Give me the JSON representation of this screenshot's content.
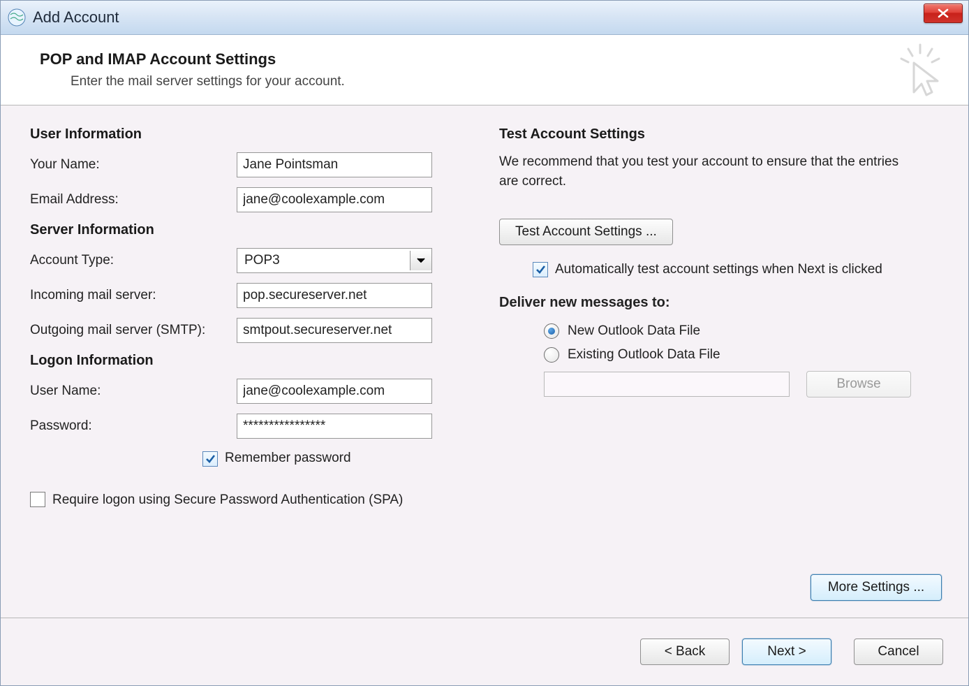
{
  "window": {
    "title": "Add Account"
  },
  "header": {
    "title": "POP and IMAP Account Settings",
    "subtitle": "Enter the mail server settings for your account."
  },
  "user_info": {
    "section": "User Information",
    "name_label": "Your Name:",
    "name_value": "Jane Pointsman",
    "email_label": "Email Address:",
    "email_value": "jane@coolexample.com"
  },
  "server_info": {
    "section": "Server Information",
    "type_label": "Account Type:",
    "type_value": "POP3",
    "incoming_label": "Incoming mail server:",
    "incoming_value": "pop.secureserver.net",
    "outgoing_label": "Outgoing mail server (SMTP):",
    "outgoing_value": "smtpout.secureserver.net"
  },
  "logon": {
    "section": "Logon Information",
    "user_label": "User Name:",
    "user_value": "jane@coolexample.com",
    "pass_label": "Password:",
    "pass_value": "****************",
    "remember_label": "Remember password",
    "remember_checked": true,
    "spa_label": "Require logon using Secure Password Authentication (SPA)",
    "spa_checked": false
  },
  "test": {
    "section": "Test Account Settings",
    "description": "We recommend that you test your account to ensure that the entries are correct.",
    "button": "Test Account Settings ...",
    "auto_label": "Automatically test account settings when Next is clicked",
    "auto_checked": true
  },
  "deliver": {
    "section": "Deliver new messages to:",
    "new_label": "New Outlook Data File",
    "existing_label": "Existing Outlook Data File",
    "selected": "new",
    "browse": "Browse"
  },
  "more_settings": "More Settings ...",
  "footer": {
    "back": "< Back",
    "next": "Next >",
    "cancel": "Cancel"
  }
}
